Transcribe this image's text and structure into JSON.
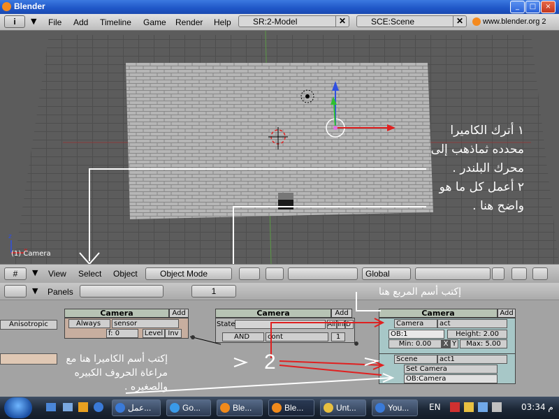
{
  "window": {
    "title": "Blender",
    "controls": [
      "_",
      "□",
      "×"
    ]
  },
  "menubar": {
    "menus": [
      "File",
      "Add",
      "Timeline",
      "Game",
      "Render",
      "Help"
    ],
    "screen_field": "SR:2-Model",
    "scene_field": "SCE:Scene",
    "url": "www.blender.org 2"
  },
  "viewport": {
    "object_label": "(1) Camera",
    "note1_lines": [
      "١ أترك الكاميرا",
      "محدده ثماذهب إلى",
      "محرك البلندر .",
      "٢ أعمل كل ما هو",
      "واضح هنا ."
    ]
  },
  "header3d": {
    "menus": [
      "View",
      "Select",
      "Object"
    ],
    "mode": "Object Mode",
    "orientation": "Global"
  },
  "logic": {
    "panels_label": "Panels",
    "frame_value": "1",
    "anisotropic_label": "Anisotropic",
    "sensors": {
      "header": "Camera",
      "add": "Add",
      "type": "Always",
      "name": "sensor",
      "freq": "f: 0",
      "level": "Level",
      "inv": "Inv"
    },
    "controllers": {
      "header": "Camera",
      "add": "Add",
      "state_label": "State",
      "all": "All",
      "ini": "Ini",
      "d": "D",
      "type": "AND",
      "name": "cont",
      "count": "1"
    },
    "actuators": {
      "header": "Camera",
      "add": "Add",
      "a1_type": "Camera",
      "a1_name": "act",
      "ob_field": "OB:1",
      "height": "Height: 2.00",
      "min": "Min: 0.00",
      "x": "X",
      "y": "Y",
      "max": "Max: 5.00",
      "a2_type": "Scene",
      "a2_name": "act1",
      "set_camera": "Set Camera",
      "ob_camera": "OB:Camera"
    },
    "note_box_name": "إكتب أسم المربع هنا",
    "note_camera_lines": [
      "إكتب أسم الكاميرا هنا مع",
      "مراعاة الحروف الكبيره",
      "والصغيره ."
    ],
    "number2": "2"
  },
  "taskbar": {
    "tasks": [
      "عمل...",
      "Go...",
      "Ble...",
      "Ble...",
      "Unt...",
      "You..."
    ],
    "lang": "EN",
    "clock": "03:34 م"
  },
  "colors": {
    "titlebar": "#1f56c7",
    "viewport": "#5c5c5c",
    "grid_plane": "#b4b4b4",
    "annotation_red": "#e02020",
    "annotation_white": "#ffffff"
  }
}
